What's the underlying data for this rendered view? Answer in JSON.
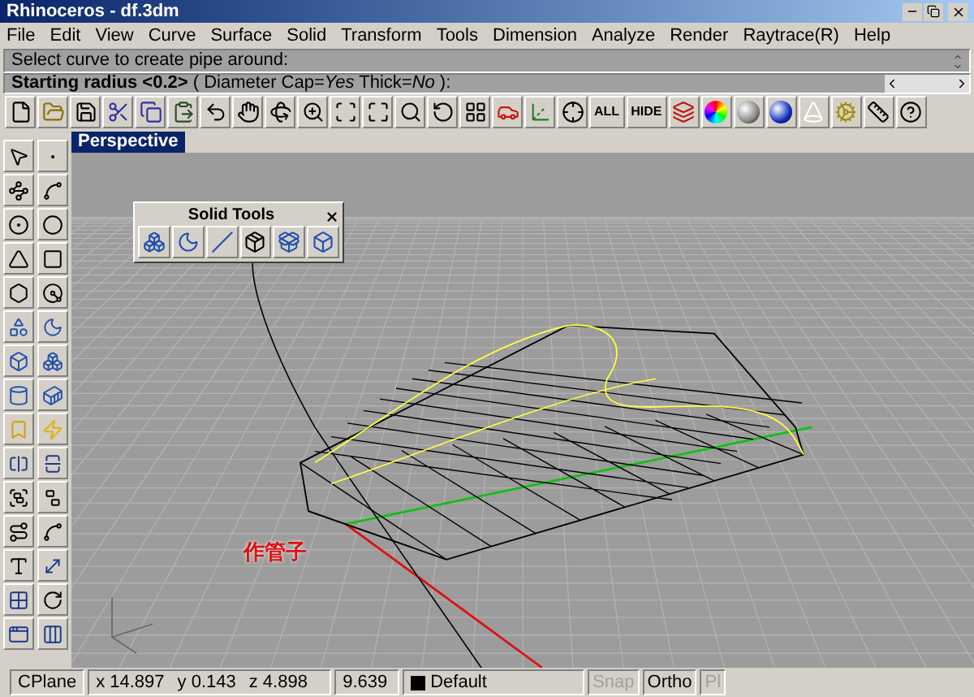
{
  "window": {
    "title": "Rhinoceros - df.3dm"
  },
  "menu": [
    "File",
    "Edit",
    "View",
    "Curve",
    "Surface",
    "Solid",
    "Transform",
    "Tools",
    "Dimension",
    "Analyze",
    "Render",
    "Raytrace(R)",
    "Help"
  ],
  "command": {
    "history": "Select curve to create pipe around:",
    "prompt": "**Starting radius <0.2>** ( Diameter Cap=*Yes* Thick=*No* ):"
  },
  "toolbar_labels": [
    "ALL",
    "HIDE"
  ],
  "viewport": {
    "title": "Perspective",
    "annotation": "作管子"
  },
  "floating_toolbar": {
    "title": "Solid Tools"
  },
  "status_bar": {
    "cplane": "CPlane",
    "x": "x 14.897",
    "y": "y 0.143",
    "z": "z 4.898",
    "distance": "9.639",
    "layer": {
      "name": "Default",
      "color": "#000000"
    },
    "toggles": [
      {
        "label": "Snap",
        "on": false
      },
      {
        "label": "Ortho",
        "on": true
      },
      {
        "label": "Pl",
        "on": false
      }
    ]
  }
}
